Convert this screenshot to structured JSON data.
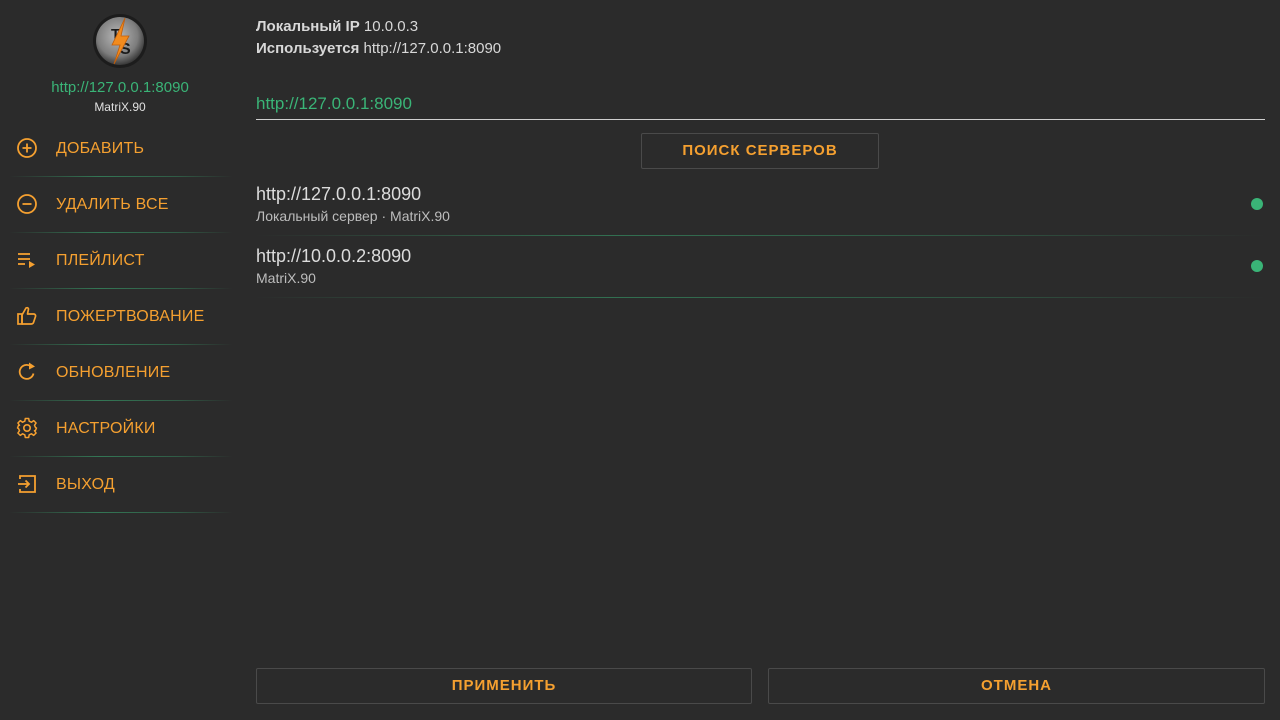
{
  "sidebar": {
    "logo_letters": "TS",
    "host": "http://127.0.0.1:8090",
    "version": "MatriX.90",
    "items": [
      {
        "label": "ДОБАВИТЬ",
        "icon": "add-circle-icon"
      },
      {
        "label": "УДАЛИТЬ ВСЕ",
        "icon": "remove-circle-icon"
      },
      {
        "label": "ПЛЕЙЛИСТ",
        "icon": "playlist-icon"
      },
      {
        "label": "ПОЖЕРТВОВАНИЕ",
        "icon": "thumb-up-icon"
      },
      {
        "label": "ОБНОВЛЕНИЕ",
        "icon": "refresh-icon"
      },
      {
        "label": "НАСТРОЙКИ",
        "icon": "gear-icon"
      },
      {
        "label": "ВЫХОД",
        "icon": "exit-icon"
      }
    ]
  },
  "main": {
    "local_ip_label": "Локальный IP",
    "local_ip_value": "10.0.0.3",
    "in_use_label": "Используется",
    "in_use_value": "http://127.0.0.1:8090",
    "url_input_value": "http://127.0.0.1:8090",
    "search_button": "ПОИСК СЕРВЕРОВ",
    "servers": [
      {
        "host": "http://127.0.0.1:8090",
        "description": "Локальный сервер · MatriX.90",
        "status": "online"
      },
      {
        "host": "http://10.0.0.2:8090",
        "description": "MatriX.90",
        "status": "online"
      }
    ],
    "apply_button": "ПРИМЕНИТЬ",
    "cancel_button": "ОТМЕНА"
  },
  "colors": {
    "background": "#2b2b2b",
    "accent_orange": "#f5a030",
    "accent_green": "#3ab477",
    "text_light": "#d8d8d8"
  }
}
